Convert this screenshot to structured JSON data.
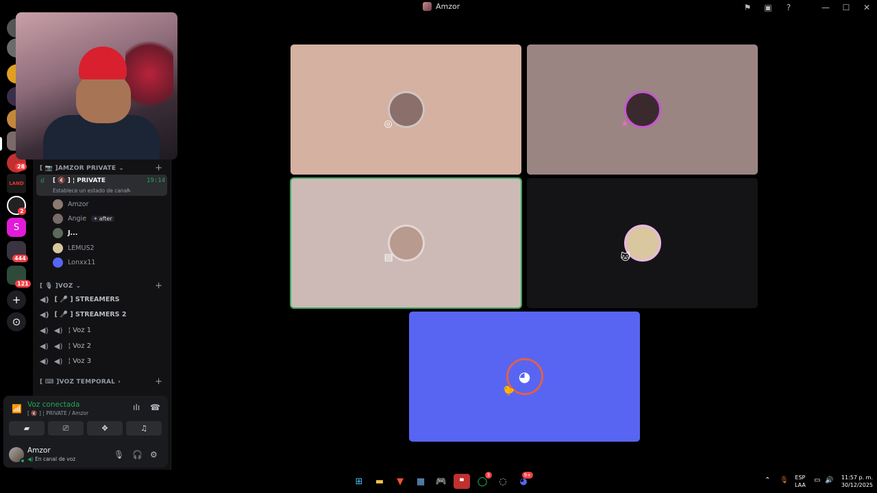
{
  "window": {
    "title": "Amzor",
    "icons": {
      "inbox": "⚑",
      "popout": "▣",
      "help": "?",
      "minimize": "—",
      "maximize": "☐",
      "close": "✕"
    }
  },
  "servers": {
    "badges": [
      "28",
      "2",
      "444",
      "121"
    ],
    "named_label": "LAND",
    "s_label": "S",
    "add_label": "+",
    "discover_label": "⊙"
  },
  "sidebar": {
    "category_private": "[ 📷 ]AMZOR PRIVATE",
    "active_channel": {
      "name": "[ 🔇 ] ¦ PRIVATE",
      "time": "19:14",
      "status": "Establece un estado de canal"
    },
    "members": [
      {
        "name": "Amzor",
        "tag": ""
      },
      {
        "name": "Angie",
        "tag": "after"
      },
      {
        "name": "J...",
        "tag": ""
      },
      {
        "name": "LEMUS2",
        "tag": ""
      },
      {
        "name": "Lonxx11",
        "tag": ""
      }
    ],
    "category_voz": "[ 🎙 ]VOZ",
    "voice_channels": [
      "[ 🎤 ] STREAMERS",
      "[ 🎤 ] STREAMERS 2",
      "¦ Voz 1",
      "¦ Voz 2",
      "¦ Voz 3"
    ],
    "category_temp": "[ ⌨ ]VOZ TEMPORAL"
  },
  "voice_panel": {
    "title": "Voz conectada",
    "subtitle": "[ 🔇 ] ¦ PRIVATE / Amzor"
  },
  "user": {
    "name": "Amzor",
    "status": "En canal de voz"
  },
  "stage": {
    "tiles": [
      {
        "color": "#d4b1a1",
        "avatar_color": "#8b6f6a",
        "glyph": "◉"
      },
      {
        "color": "#9a8582",
        "avatar_color": "#3a2a2e",
        "glyph": "◉"
      },
      {
        "color": "#cdbab6",
        "avatar_color": "#b89a8e",
        "glyph": "◉"
      },
      {
        "color": "#141416",
        "avatar_color": "#d9c7a0",
        "glyph": "◉"
      },
      {
        "color": "#5865f2",
        "avatar_color": "#5865f2",
        "glyph": "◉"
      }
    ]
  },
  "taskbar": {
    "lang1": "ESP",
    "lang2": "LAA",
    "time": "11:57 p. m.",
    "date": "30/12/2025",
    "whatsapp_badge": "3",
    "discord_badge": "9+"
  }
}
